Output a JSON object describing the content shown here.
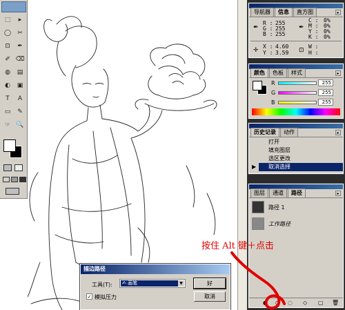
{
  "toolbox": {
    "tools": [
      "⬚",
      "▸",
      "◯",
      "✂",
      "⊡",
      "✒",
      "✐",
      "⌫",
      "◍",
      "▤",
      "◐",
      "▣",
      "T",
      "A",
      "▭",
      "✎",
      "☞",
      "🔍"
    ]
  },
  "info_panel": {
    "tabs": [
      "导航器",
      "信息",
      "直方图"
    ],
    "active_tab": "信息",
    "rgb": {
      "r_label": "R :",
      "g_label": "G :",
      "b_label": "B :",
      "r": "255",
      "g": "255",
      "b": "255"
    },
    "cmyk": {
      "c_label": "C :",
      "m_label": "M :",
      "y_label": "Y :",
      "k_label": "K :",
      "c": "0%",
      "m": "0%",
      "y": "0%",
      "k": "0%"
    },
    "xy": {
      "x_label": "X :",
      "y_label": "Y :",
      "x": "4.60",
      "y": "3.59"
    },
    "wh": {
      "w_label": "W :",
      "h_label": "H :"
    }
  },
  "color_panel": {
    "tabs": [
      "颜色",
      "色板",
      "样式"
    ],
    "active_tab": "颜色",
    "channels": [
      {
        "label": "R",
        "value": "255"
      },
      {
        "label": "G",
        "value": "255"
      },
      {
        "label": "B",
        "value": "255"
      }
    ]
  },
  "history_panel": {
    "tabs": [
      "历史记录",
      "动作"
    ],
    "active_tab": "历史记录",
    "items": [
      "打开",
      "填充图层",
      "选区更改",
      "取消选择"
    ],
    "selected_index": 3
  },
  "paths_panel": {
    "tabs": [
      "图层",
      "通道",
      "路径"
    ],
    "active_tab": "路径",
    "items": [
      "路径 1",
      "工作路径"
    ]
  },
  "dialog": {
    "title": "描边路径",
    "tool_label": "工具(T):",
    "tool_value": "画笔",
    "simulate_pressure_label": "模拟压力",
    "simulate_pressure_checked": true,
    "ok_label": "好",
    "cancel_label": "取消"
  },
  "annotation": {
    "text": "按住 Alt 键＋点击",
    "color": "#e00000"
  },
  "colors": {
    "titlebar": "#0a246a",
    "panel_bg": "#d4d0c8",
    "workspace": "#2b2b2b",
    "annotation_red": "#e00000"
  }
}
